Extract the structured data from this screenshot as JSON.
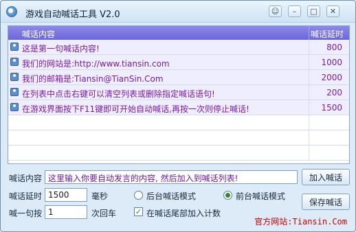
{
  "window": {
    "title": "游戏自动喊话工具 V2.0",
    "controls": {
      "chat": "☺",
      "minimize": "–",
      "maximize": "□",
      "close": "✕"
    }
  },
  "list": {
    "headers": {
      "message": "喊话内容",
      "delay": "喊话延时"
    },
    "rows": [
      {
        "text": "这是第一句喊话内容!",
        "delay": "800"
      },
      {
        "text": "我们的网站是:http://www.tiansin.com",
        "delay": "1000"
      },
      {
        "text": "我们的邮箱是:Tiansin@TianSin.Com",
        "delay": "2000"
      },
      {
        "text": "在列表中点击右键可以清空列表或删除指定喊话语句!",
        "delay": "200"
      },
      {
        "text": "在游戏界面按下F11键即可开始自动喊话,再按一次则停止喊话!",
        "delay": "1500"
      }
    ],
    "empty_row_count": 3
  },
  "form": {
    "message_label": "喊话内容",
    "message_value": "这里输入你要自动发言的内容, 然后加入到喊话列表!",
    "add_button": "加入喊话",
    "delay_label": "喊话延时",
    "delay_value": "1500",
    "delay_unit": "毫秒",
    "mode_background": "后台喊话模式",
    "mode_foreground": "前台喊话模式",
    "selected_mode": "foreground",
    "save_button": "保存喊话",
    "press_label": "喊一句按",
    "press_value": "1",
    "press_unit": "次回车",
    "append_count_label": "在喊话尾部加入计数",
    "append_count_checked": true
  },
  "footer": {
    "website": "官方网站:Tiansin.Com"
  },
  "colors": {
    "header_bg": "#7b77e0",
    "row_text": "#7a1aa8",
    "footer_text": "#c00000",
    "window_bg": "#dcebf7"
  }
}
